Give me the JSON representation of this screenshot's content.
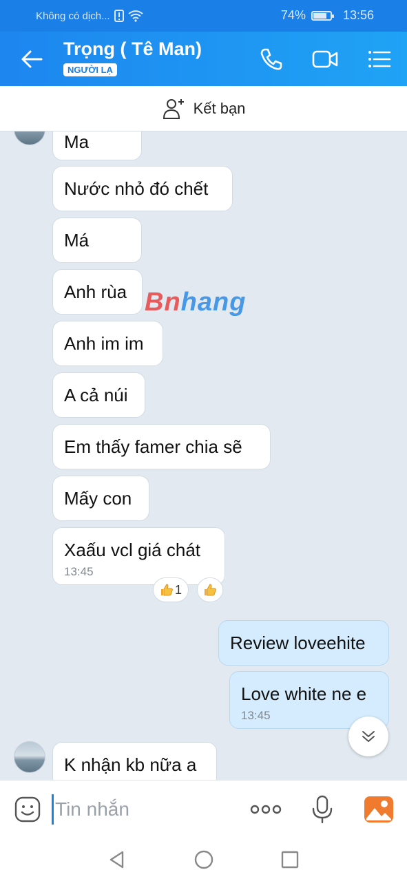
{
  "status_bar": {
    "network": "Không có dịch...",
    "battery_percent": "74%",
    "battery_level": 0.74,
    "time": "13:56"
  },
  "header": {
    "contact_name": "Trọng ( Tê Man)",
    "badge": "NGƯỜI LẠ"
  },
  "add_friend": {
    "label": "Kết bạn"
  },
  "messages": [
    {
      "text": "Ma",
      "from": "them"
    },
    {
      "text": "Nước nhỏ đó chết",
      "from": "them"
    },
    {
      "text": "Má",
      "from": "them"
    },
    {
      "text": "Anh rùa",
      "from": "them"
    },
    {
      "text": "Anh im im",
      "from": "them"
    },
    {
      "text": "A cả núi",
      "from": "them"
    },
    {
      "text": "Em thấy famer chia sẽ",
      "from": "them"
    },
    {
      "text": "Mấy con",
      "from": "them"
    },
    {
      "text": "Xaấu vcl giá chát",
      "from": "them",
      "time": "13:45"
    },
    {
      "text": "Review loveehite",
      "from": "me"
    },
    {
      "text": "Love white ne e",
      "from": "me",
      "time": "13:45"
    },
    {
      "text": "K nhận kb nữa a",
      "from": "them"
    }
  ],
  "reactions": {
    "count_label": "1"
  },
  "watermark": {
    "part1": "Bn",
    "part2": "hang"
  },
  "composer": {
    "placeholder": "Tin nhắn"
  },
  "colors": {
    "primary": "#1a7fe6",
    "bubble_me": "#d4ecfd",
    "bubble_them": "#ffffff",
    "chat_bg": "#e2e9f1"
  }
}
